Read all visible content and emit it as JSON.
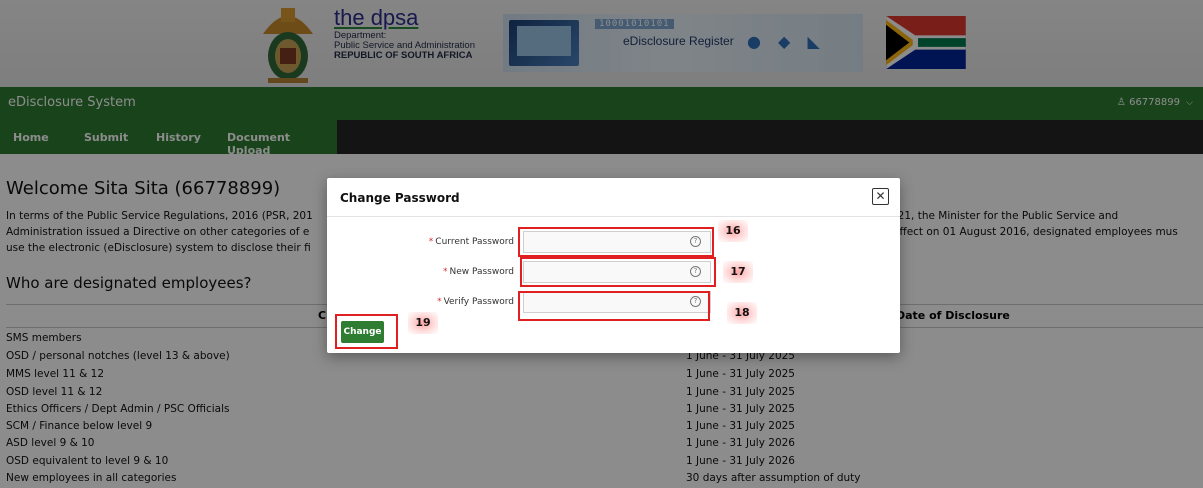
{
  "banner": {
    "org_name": "the dpsa",
    "org_line1": "Department:",
    "org_line2": "Public Service and Administration",
    "org_line3": "REPUBLIC OF SOUTH AFRICA",
    "register_title": "eDisclosure Register",
    "register_binary": "10001010101"
  },
  "appbar": {
    "title": "eDisclosure System",
    "user": "66778899"
  },
  "nav": {
    "tabs": [
      "Home",
      "Submit",
      "History",
      "Document Upload"
    ]
  },
  "main": {
    "welcome": "Welcome Sita Sita (66778899)",
    "intro_left": [
      "In terms of the Public Service Regulations, 2016 (PSR, 201",
      "Administration issued a Directive on other categories of e",
      "use the electronic (eDisclosure) system to disclose their fi"
    ],
    "intro_right": [
      "021, the Minister for the Public Service and",
      "effect on 01 August 2016, designated employees mus"
    ],
    "who_heading": "Who are designated employees?",
    "col1_partial": "C",
    "col2_partial": "Date of Disclosure",
    "rows": [
      {
        "category": "SMS members",
        "date": ""
      },
      {
        "category": "OSD / personal notches (level 13 & above)",
        "date": "1 June - 31 July 2025"
      },
      {
        "category": "MMS level 11 & 12",
        "date": "1 June - 31 July 2025"
      },
      {
        "category": "OSD level 11 & 12",
        "date": "1 June - 31 July 2025"
      },
      {
        "category": "Ethics Officers / Dept Admin / PSC Officials",
        "date": "1 June - 31 July 2025"
      },
      {
        "category": "SCM / Finance below level 9",
        "date": "1 June - 31 July 2025"
      },
      {
        "category": "ASD level 9 & 10",
        "date": "1 June - 31 July 2026"
      },
      {
        "category": "OSD equivalent to level 9 & 10",
        "date": "1 June - 31 July 2026"
      },
      {
        "category": "New employees in all categories",
        "date": "30 days after assumption of duty"
      }
    ]
  },
  "modal": {
    "title": "Change Password",
    "close_glyph": "✕",
    "required_mark": "*",
    "help_glyph": "?",
    "fields": [
      {
        "label": "Current Password",
        "value": "",
        "annotation": "16"
      },
      {
        "label": "New Password",
        "value": "",
        "annotation": "17"
      },
      {
        "label": "Verify Password",
        "value": "",
        "annotation": "18"
      }
    ],
    "change_label": "Change",
    "change_annotation": "19"
  },
  "colors": {
    "brand_green": "#2e7d32",
    "nav_dark": "#262626",
    "annotation_red": "#e02020"
  }
}
